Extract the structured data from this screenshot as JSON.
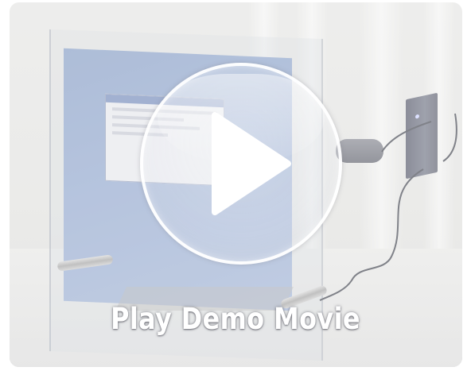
{
  "video": {
    "play_label": "Play Demo Movie",
    "play_icon": "play-icon"
  },
  "colors": {
    "label_text": "#ffffff",
    "play_ring": "#ffffff",
    "backdrop": "#e3e3e1",
    "screen_blue": "#98acd0"
  }
}
